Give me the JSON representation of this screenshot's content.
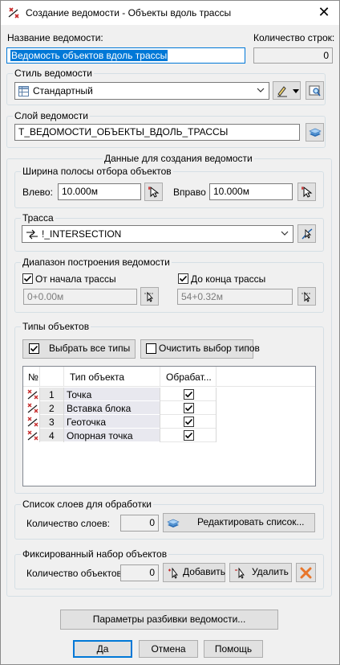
{
  "window": {
    "title": "Создание ведомости - Объекты вдоль трассы",
    "close_glyph": "✕"
  },
  "report_name": {
    "label": "Название ведомости:",
    "value": "Ведомость объектов вдоль трассы"
  },
  "row_count": {
    "label": "Количество строк:",
    "value": "0"
  },
  "style": {
    "label": "Стиль ведомости",
    "value": "Стандартный"
  },
  "layer": {
    "label": "Слой ведомости",
    "value": "T_ВЕДОМОСТИ_ОБЪЕКТЫ_ВДОЛЬ_ТРАССЫ"
  },
  "data_section": {
    "label": "Данные для создания ведомости"
  },
  "strip_width": {
    "label": "Ширина полосы отбора объектов",
    "left_label": "Влево:",
    "left_value": "10.000м",
    "right_label": "Вправо",
    "right_value": "10.000м"
  },
  "alignment": {
    "label": "Трасса",
    "value": "!_INTERSECTION"
  },
  "range": {
    "label": "Диапазон построения ведомости",
    "from_start_label": "От начала трассы",
    "from_start_checked": true,
    "start_value": "0+0.00м",
    "to_end_label": "До конца трассы",
    "to_end_checked": true,
    "end_value": "54+0.32м"
  },
  "object_types": {
    "label": "Типы объектов",
    "select_all_label": "Выбрать все типы",
    "clear_label": "Очистить выбор типов",
    "columns": [
      "№",
      "Тип объекта",
      "Обрабат..."
    ],
    "rows": [
      {
        "num": "1",
        "type": "Точка",
        "checked": true
      },
      {
        "num": "2",
        "type": "Вставка блока",
        "checked": true
      },
      {
        "num": "3",
        "type": "Геоточка",
        "checked": true
      },
      {
        "num": "4",
        "type": "Опорная точка",
        "checked": true
      }
    ]
  },
  "layers_list": {
    "label": "Список слоев для обработки",
    "count_label": "Количество слоев:",
    "count_value": "0",
    "edit_label": "Редактировать список..."
  },
  "fixed_set": {
    "label": "Фиксированный набор объектов",
    "count_label": "Количество объектов:",
    "count_value": "0",
    "add_label": "Добавить",
    "remove_label": "Удалить"
  },
  "split_params_label": "Параметры разбивки ведомости...",
  "footer": {
    "ok_label": "Да",
    "cancel_label": "Отмена",
    "help_label": "Помощь"
  },
  "colors": {
    "accent": "#0078d7",
    "delete_icon": "#e8762b",
    "group_border": "#d5dfe5"
  }
}
